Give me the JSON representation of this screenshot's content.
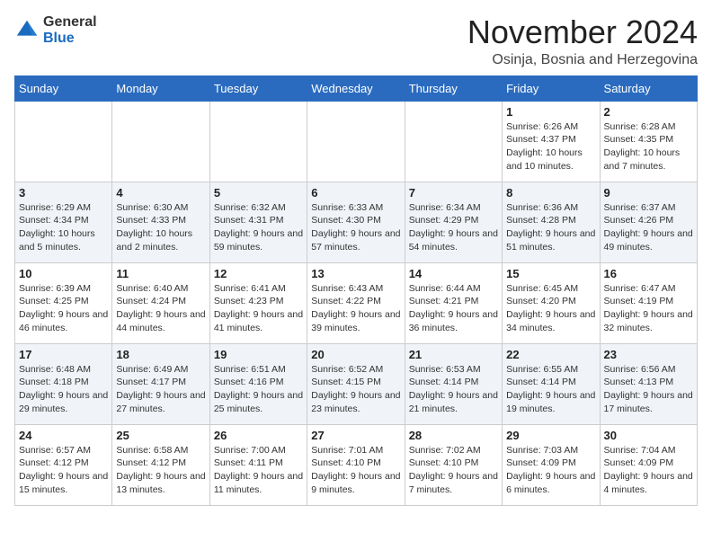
{
  "logo": {
    "general": "General",
    "blue": "Blue"
  },
  "header": {
    "month_title": "November 2024",
    "location": "Osinja, Bosnia and Herzegovina"
  },
  "weekdays": [
    "Sunday",
    "Monday",
    "Tuesday",
    "Wednesday",
    "Thursday",
    "Friday",
    "Saturday"
  ],
  "weeks": [
    [
      {
        "day": "",
        "info": ""
      },
      {
        "day": "",
        "info": ""
      },
      {
        "day": "",
        "info": ""
      },
      {
        "day": "",
        "info": ""
      },
      {
        "day": "",
        "info": ""
      },
      {
        "day": "1",
        "info": "Sunrise: 6:26 AM\nSunset: 4:37 PM\nDaylight: 10 hours and 10 minutes."
      },
      {
        "day": "2",
        "info": "Sunrise: 6:28 AM\nSunset: 4:35 PM\nDaylight: 10 hours and 7 minutes."
      }
    ],
    [
      {
        "day": "3",
        "info": "Sunrise: 6:29 AM\nSunset: 4:34 PM\nDaylight: 10 hours and 5 minutes."
      },
      {
        "day": "4",
        "info": "Sunrise: 6:30 AM\nSunset: 4:33 PM\nDaylight: 10 hours and 2 minutes."
      },
      {
        "day": "5",
        "info": "Sunrise: 6:32 AM\nSunset: 4:31 PM\nDaylight: 9 hours and 59 minutes."
      },
      {
        "day": "6",
        "info": "Sunrise: 6:33 AM\nSunset: 4:30 PM\nDaylight: 9 hours and 57 minutes."
      },
      {
        "day": "7",
        "info": "Sunrise: 6:34 AM\nSunset: 4:29 PM\nDaylight: 9 hours and 54 minutes."
      },
      {
        "day": "8",
        "info": "Sunrise: 6:36 AM\nSunset: 4:28 PM\nDaylight: 9 hours and 51 minutes."
      },
      {
        "day": "9",
        "info": "Sunrise: 6:37 AM\nSunset: 4:26 PM\nDaylight: 9 hours and 49 minutes."
      }
    ],
    [
      {
        "day": "10",
        "info": "Sunrise: 6:39 AM\nSunset: 4:25 PM\nDaylight: 9 hours and 46 minutes."
      },
      {
        "day": "11",
        "info": "Sunrise: 6:40 AM\nSunset: 4:24 PM\nDaylight: 9 hours and 44 minutes."
      },
      {
        "day": "12",
        "info": "Sunrise: 6:41 AM\nSunset: 4:23 PM\nDaylight: 9 hours and 41 minutes."
      },
      {
        "day": "13",
        "info": "Sunrise: 6:43 AM\nSunset: 4:22 PM\nDaylight: 9 hours and 39 minutes."
      },
      {
        "day": "14",
        "info": "Sunrise: 6:44 AM\nSunset: 4:21 PM\nDaylight: 9 hours and 36 minutes."
      },
      {
        "day": "15",
        "info": "Sunrise: 6:45 AM\nSunset: 4:20 PM\nDaylight: 9 hours and 34 minutes."
      },
      {
        "day": "16",
        "info": "Sunrise: 6:47 AM\nSunset: 4:19 PM\nDaylight: 9 hours and 32 minutes."
      }
    ],
    [
      {
        "day": "17",
        "info": "Sunrise: 6:48 AM\nSunset: 4:18 PM\nDaylight: 9 hours and 29 minutes."
      },
      {
        "day": "18",
        "info": "Sunrise: 6:49 AM\nSunset: 4:17 PM\nDaylight: 9 hours and 27 minutes."
      },
      {
        "day": "19",
        "info": "Sunrise: 6:51 AM\nSunset: 4:16 PM\nDaylight: 9 hours and 25 minutes."
      },
      {
        "day": "20",
        "info": "Sunrise: 6:52 AM\nSunset: 4:15 PM\nDaylight: 9 hours and 23 minutes."
      },
      {
        "day": "21",
        "info": "Sunrise: 6:53 AM\nSunset: 4:14 PM\nDaylight: 9 hours and 21 minutes."
      },
      {
        "day": "22",
        "info": "Sunrise: 6:55 AM\nSunset: 4:14 PM\nDaylight: 9 hours and 19 minutes."
      },
      {
        "day": "23",
        "info": "Sunrise: 6:56 AM\nSunset: 4:13 PM\nDaylight: 9 hours and 17 minutes."
      }
    ],
    [
      {
        "day": "24",
        "info": "Sunrise: 6:57 AM\nSunset: 4:12 PM\nDaylight: 9 hours and 15 minutes."
      },
      {
        "day": "25",
        "info": "Sunrise: 6:58 AM\nSunset: 4:12 PM\nDaylight: 9 hours and 13 minutes."
      },
      {
        "day": "26",
        "info": "Sunrise: 7:00 AM\nSunset: 4:11 PM\nDaylight: 9 hours and 11 minutes."
      },
      {
        "day": "27",
        "info": "Sunrise: 7:01 AM\nSunset: 4:10 PM\nDaylight: 9 hours and 9 minutes."
      },
      {
        "day": "28",
        "info": "Sunrise: 7:02 AM\nSunset: 4:10 PM\nDaylight: 9 hours and 7 minutes."
      },
      {
        "day": "29",
        "info": "Sunrise: 7:03 AM\nSunset: 4:09 PM\nDaylight: 9 hours and 6 minutes."
      },
      {
        "day": "30",
        "info": "Sunrise: 7:04 AM\nSunset: 4:09 PM\nDaylight: 9 hours and 4 minutes."
      }
    ]
  ]
}
